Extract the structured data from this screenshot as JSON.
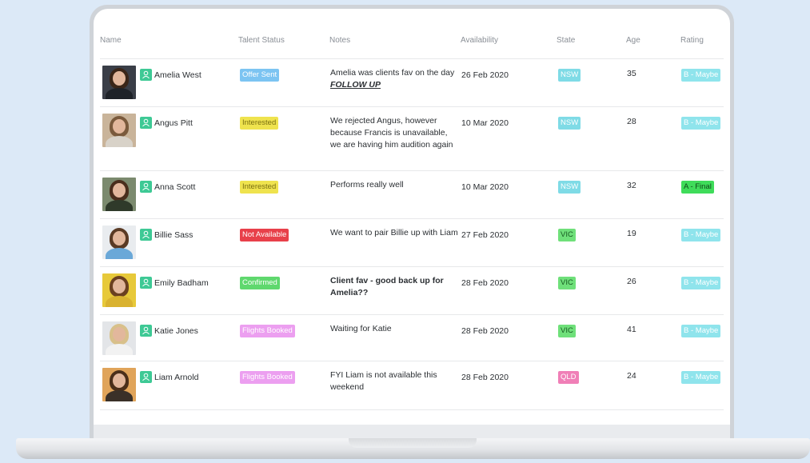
{
  "columns": {
    "name": "Name",
    "status": "Talent Status",
    "notes": "Notes",
    "availability": "Availability",
    "state": "State",
    "age": "Age",
    "rating": "Rating"
  },
  "colors": {
    "offer_sent": "#7cc4f2",
    "interested": "#efe34e",
    "not_available": "#e8404a",
    "confirmed": "#5fd86e",
    "flights_booked": "#ec9ff0",
    "state_nsw": "#7fdbe6",
    "state_vic": "#6fe07a",
    "state_qld": "#f07fb7",
    "rating_b": "#8fe4ec",
    "rating_a": "#3fdc5a",
    "person_icon": "#3ec995"
  },
  "rows": [
    {
      "name": "Amelia West",
      "status": "Offer Sent",
      "status_key": "offer_sent",
      "notes": "Amelia was clients fav on the day ",
      "notes_emphasis": "FOLLOW UP",
      "availability": "26 Feb 2020",
      "state": "NSW",
      "age": "35",
      "rating": "B - Maybe"
    },
    {
      "name": "Angus Pitt",
      "status": "Interested",
      "status_key": "interested",
      "notes": "We rejected Angus, however because Francis is unavailable, we are having him audition again",
      "availability": "10 Mar 2020",
      "state": "NSW",
      "age": "28",
      "rating": "B - Maybe"
    },
    {
      "name": "Anna Scott",
      "status": "Interested",
      "status_key": "interested",
      "notes": "Performs really well",
      "availability": "10 Mar 2020",
      "state": "NSW",
      "age": "32",
      "rating": "A - Final"
    },
    {
      "name": "Billie Sass",
      "status": "Not Available",
      "status_key": "not_available",
      "notes": "We want to pair Billie up with Liam",
      "availability": "27 Feb 2020",
      "state": "VIC",
      "age": "19",
      "rating": "B - Maybe"
    },
    {
      "name": "Emily Badham",
      "status": "Confirmed",
      "status_key": "confirmed",
      "notes": "Client fav - good back up for Amelia??",
      "availability": "28 Feb 2020",
      "state": "VIC",
      "age": "26",
      "rating": "B - Maybe"
    },
    {
      "name": "Katie Jones",
      "status": "Flights Booked",
      "status_key": "flights_booked",
      "notes": "Waiting for Katie",
      "availability": "28 Feb 2020",
      "state": "VIC",
      "age": "41",
      "rating": "B - Maybe"
    },
    {
      "name": "Liam Arnold",
      "status": "Flights Booked",
      "status_key": "flights_booked",
      "notes": "FYI Liam is not available this weekend",
      "availability": "28 Feb 2020",
      "state": "QLD",
      "age": "24",
      "rating": "B - Maybe"
    }
  ]
}
